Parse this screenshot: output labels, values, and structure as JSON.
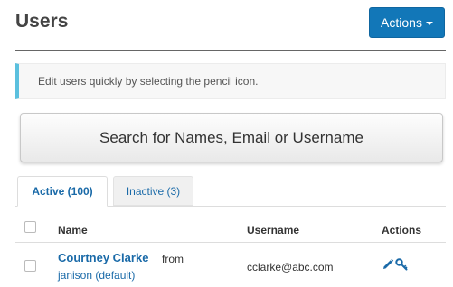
{
  "header": {
    "title": "Users",
    "actions_label": "Actions"
  },
  "info": {
    "text": "Edit users quickly by selecting the pencil icon."
  },
  "search": {
    "label": "Search for Names, Email or Username"
  },
  "tabs": [
    {
      "label": "Active (100)",
      "active": true
    },
    {
      "label": "Inactive (3)",
      "active": false
    }
  ],
  "table": {
    "columns": [
      "Name",
      "Username",
      "Actions"
    ],
    "rows": [
      {
        "name": "Courtney Clarke",
        "from_label": "from",
        "organization": "janison (default)",
        "username": "cclarke@abc.com",
        "actions": [
          "pencil-icon",
          "key-icon"
        ]
      }
    ]
  },
  "colors": {
    "primary": "#1277b8",
    "link": "#1a6aa8",
    "info_accent": "#5bc0de"
  }
}
